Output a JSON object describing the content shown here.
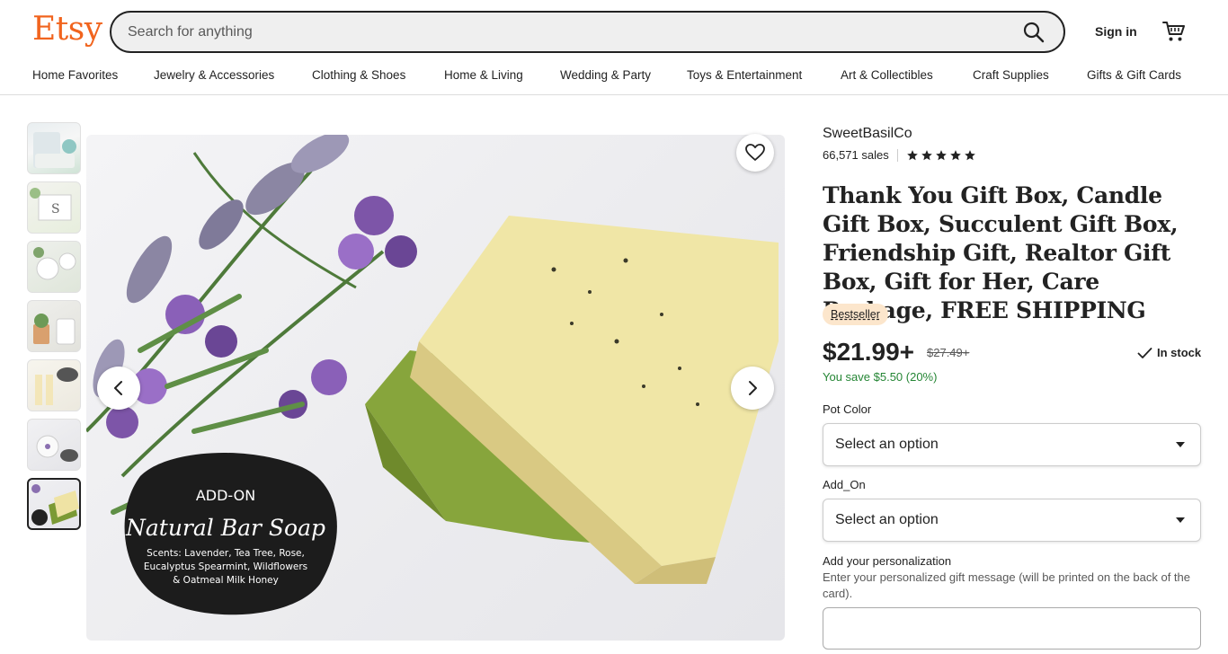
{
  "header": {
    "logo": "Etsy",
    "search_placeholder": "Search for anything",
    "sign_in": "Sign in"
  },
  "nav": [
    "Home Favorites",
    "Jewelry & Accessories",
    "Clothing & Shoes",
    "Home & Living",
    "Wedding & Party",
    "Toys & Entertainment",
    "Art & Collectibles",
    "Craft Supplies",
    "Gifts & Gift Cards"
  ],
  "image": {
    "thumb_count": 7,
    "active_thumb": 7,
    "overlay_line1": "ADD-ON",
    "overlay_line2": "Natural Bar Soap",
    "overlay_scents_1": "Scents: Lavender, Tea Tree, Rose,",
    "overlay_scents_2": "Eucalyptus Spearmint, Wildflowers",
    "overlay_scents_3": "& Oatmeal Milk Honey"
  },
  "listing": {
    "shop_name": "SweetBasilCo",
    "sales": "66,571 sales",
    "rating_stars": 5,
    "title": "Thank You Gift Box, Candle Gift Box, Succulent Gift Box, Friendship Gift, Realtor Gift Box, Gift for Her, Care Package, FREE SHIPPING",
    "badge": "Bestseller",
    "price": "$21.99+",
    "original_price": "$27.49+",
    "stock": "In stock",
    "savings": "You save $5.50 (20%)",
    "option1_label": "Pot Color",
    "option1_value": "Select an option",
    "option2_label": "Add_On",
    "option2_value": "Select an option",
    "personalization_label": "Add your personalization",
    "personalization_hint": "Enter your personalized gift message (will be printed on the back of the card)."
  },
  "colors": {
    "brand": "#f1641e",
    "savings": "#258635",
    "badge_bg": "#fce6cc"
  }
}
